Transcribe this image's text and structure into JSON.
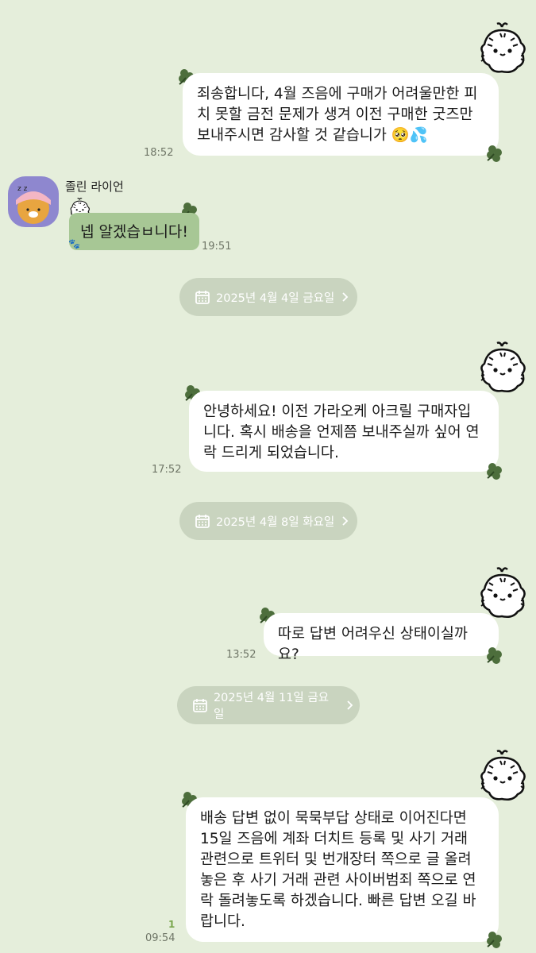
{
  "messages": [
    {
      "text": "죄송합니다, 4월 즈음에 구매가 어려울만한 피치 못할 금전 문제가 생겨 이전 구매한 굿즈만 보내주시면 감사할 것 같습니가",
      "emoji": "🥺💦",
      "time": "18:52"
    },
    {
      "sender": "졸린 라이언",
      "text": "넵 알겠습ㅂ니다!",
      "time": "19:51"
    },
    {
      "text": "안녕하세요! 이전 가라오케 아크릴 구매자입니다. 혹시 배송을 언제쯤 보내주실까 싶어 연락 드리게 되었습니다.",
      "time": "17:52"
    },
    {
      "text": "따로 답변 어려우신 상태이실까요?",
      "time": "13:52"
    },
    {
      "text": "배송 답변 없이 묵묵부답 상태로 이어진다면 15일 즈음에 계좌 더치트 등록 및 사기 거래 관련으로 트위터 및 번개장터 쪽으로 글 올려놓은 후 사기 거래 관련 사이버범죄 쪽으로 연락 돌려놓도록 하겠습니다. 빠른 답변 오길 바랍니다.",
      "time": "09:54",
      "unread": "1"
    }
  ],
  "dates": [
    "2025년 4월 4일 금요일",
    "2025년 4월 8일 화요일",
    "2025년 4월 11일 금요일"
  ],
  "icons": {
    "calendar": "calendar-icon",
    "chevron": "chevron-right-icon",
    "clover": "clover-sticker-icon",
    "tiger": "tiger-sticker-icon",
    "avatar": "ryan-avatar"
  },
  "colors": {
    "background": "#e5eedb",
    "incoming_bubble": "#a7c795",
    "outgoing_bubble": "#ffffff",
    "date_pill": "#c9d4bf"
  }
}
